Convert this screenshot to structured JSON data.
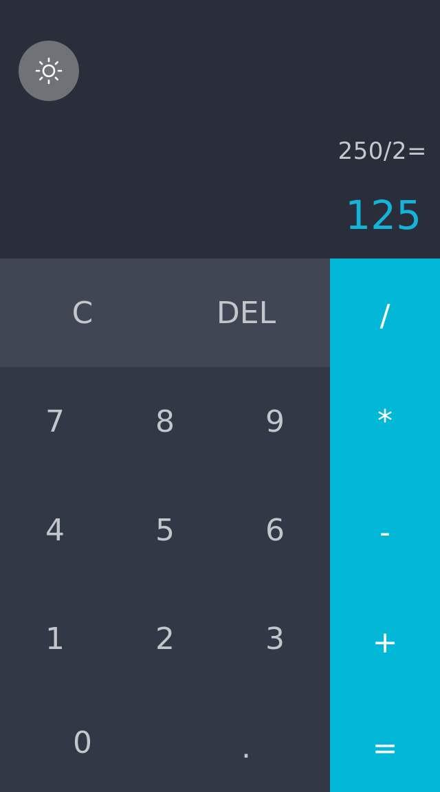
{
  "display": {
    "theme_icon": "sun-icon",
    "expression": "250/2=",
    "result": "125"
  },
  "keys": {
    "clear": "C",
    "delete": "DEL",
    "divide": "/",
    "multiply": "*",
    "subtract": "-",
    "add": "+",
    "equals": "=",
    "seven": "7",
    "eight": "8",
    "nine": "9",
    "four": "4",
    "five": "5",
    "six": "6",
    "one": "1",
    "two": "2",
    "three": "3",
    "zero": "0",
    "decimal": "."
  },
  "colors": {
    "display_bg": "#2a2e3a",
    "keypad_bg": "#313846",
    "function_row_bg": "#414654",
    "operator_bg": "#02b8d6",
    "result_text": "#15b3d7",
    "theme_button_bg": "#6f7277"
  }
}
